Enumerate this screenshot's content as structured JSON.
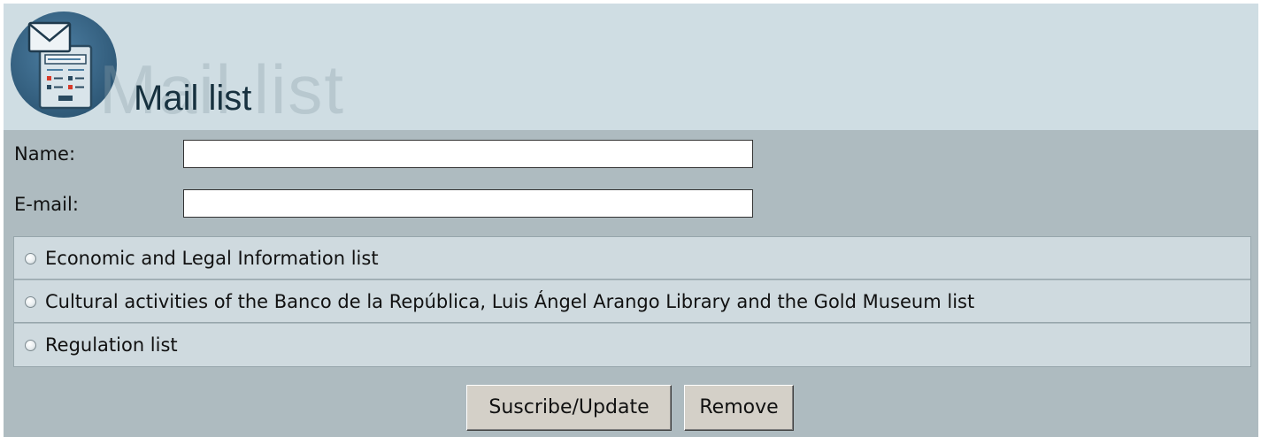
{
  "header": {
    "title": "Mail list",
    "title_shadow": "Mail list",
    "icon": "mail-list-icon"
  },
  "form": {
    "name_label": "Name:",
    "name_value": "",
    "email_label": "E-mail:",
    "email_value": ""
  },
  "lists": [
    {
      "label": "Economic and Legal Information list",
      "selected": false
    },
    {
      "label": "Cultural activities of the Banco de la República, Luis Ángel Arango Library and the Gold Museum list",
      "selected": false
    },
    {
      "label": "Regulation list",
      "selected": false
    }
  ],
  "buttons": {
    "subscribe_label": "Suscribe/Update",
    "remove_label": "Remove"
  },
  "colors": {
    "header_bg": "#cfdde3",
    "form_bg": "#aebbc0",
    "row_bg": "#cfdadf",
    "icon_circle": "#3b6a8c",
    "title_text": "#17313f"
  }
}
